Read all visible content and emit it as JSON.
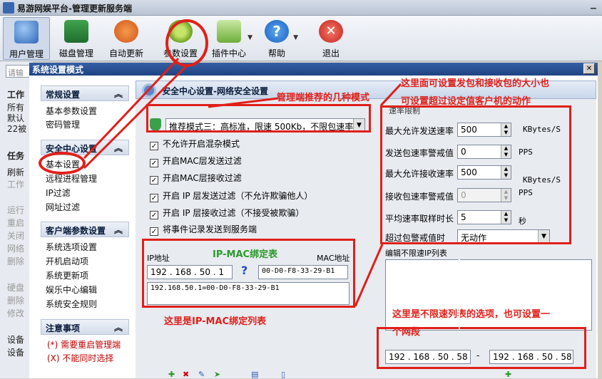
{
  "app": {
    "title": "易游网娱平台-管理更新服务端"
  },
  "toolbar": {
    "items": [
      {
        "label": "用户管理",
        "icon": "user-management-icon"
      },
      {
        "label": "磁盘管理",
        "icon": "disk-management-icon"
      },
      {
        "label": "自动更新",
        "icon": "auto-update-icon"
      },
      {
        "label": "参数设置",
        "icon": "settings-gear-icon"
      },
      {
        "label": "插件中心",
        "icon": "plugin-folder-icon"
      },
      {
        "label": "帮助",
        "icon": "help-icon"
      },
      {
        "label": "退出",
        "icon": "exit-icon"
      }
    ]
  },
  "background": {
    "search_placeholder": "请输",
    "texts": [
      "工作",
      "所有",
      "默认",
      "22被",
      "任务",
      "刷新",
      "工作",
      "运行",
      "重启",
      "关闭",
      "网络",
      "删除",
      "硬盘",
      "删除",
      "修改",
      "设备",
      "设备"
    ]
  },
  "dialog": {
    "title": "系统设置模式",
    "close": "✕"
  },
  "nav": {
    "sections": [
      {
        "title": "常规设置",
        "items": [
          "基本参数设置",
          "密码管理"
        ]
      },
      {
        "title": "安全中心设置",
        "items": [
          "基本设置",
          "远程进程管理",
          "IP过滤",
          "网址过滤"
        ]
      },
      {
        "title": "客户端参数设置",
        "items": [
          "系统选项设置",
          "开机启动项",
          "系统更新项",
          "娱乐中心编辑",
          "系统安全规则"
        ]
      },
      {
        "title": "注意事项",
        "items": []
      }
    ],
    "notes": [
      "(*) 需要重启管理端",
      "(X) 不能同时选择"
    ],
    "chevron": "︽"
  },
  "main": {
    "header_title": "安全中心设置-网络安全设置",
    "mode_select": "推荐模式三：高标准，限速 500Kb，不限包速率",
    "checkboxes": [
      {
        "label": "不允许开启混杂模式",
        "checked": true
      },
      {
        "label": "开启MAC层发送过滤",
        "checked": true
      },
      {
        "label": "开启MAC层接收过滤",
        "checked": true
      },
      {
        "label": "开启 IP 层发送过滤（不允许欺骗他人）",
        "checked": true
      },
      {
        "label": "开启 IP 层接收过滤（不接受被欺骗）",
        "checked": true
      },
      {
        "label": "将事件记录发送到服务端",
        "checked": true
      }
    ],
    "ip_label": "IP地址",
    "mac_label": "MAC地址",
    "ipmac_title": "IP-MAC绑定表",
    "ip_value": "192 . 168 . 50  . 1",
    "mac_value": "00-D0-F8-33-29-B1",
    "question": "?",
    "binding_entry": "192.168.50.1=00-D0-F8-33-29-B1",
    "rate_group": "速率限制",
    "rate_rows": [
      {
        "label": "最大允许发送速率",
        "value": "500",
        "unit": "KBytes/S"
      },
      {
        "label": "发送包速率警戒值",
        "value": "0",
        "unit": "PPS"
      },
      {
        "label": "最大允许接收速率",
        "value": "500",
        "unit": "KBytes/S"
      },
      {
        "label": "接收包速率警戒值",
        "value": "0",
        "unit": "PPS"
      },
      {
        "label": "平均速率取样时长",
        "value": "5",
        "unit": "秒"
      }
    ],
    "over_label": "超过包警戒值时",
    "over_select": "无动作",
    "nolimit_label": "编辑不限速IP列表",
    "range_from": "192 . 168 . 50  . 58",
    "range_dash": "-",
    "range_to": "192 . 168 . 50  . 58"
  },
  "annotations": {
    "modes": "管理端推荐的几种模式",
    "packet_line1": "这里面可设置发包和接收包的大小也",
    "packet_line2": "可设置超过设定值客户机的动作",
    "ipmac_list": "这里是IP-MAC绑定列表",
    "nolimit_line1": "这里是不限速列表的选项，也可设置一",
    "nolimit_line2": "个网段"
  },
  "colors": {
    "annotation_red": "#e0201a",
    "title_blue": "#1f4382"
  }
}
